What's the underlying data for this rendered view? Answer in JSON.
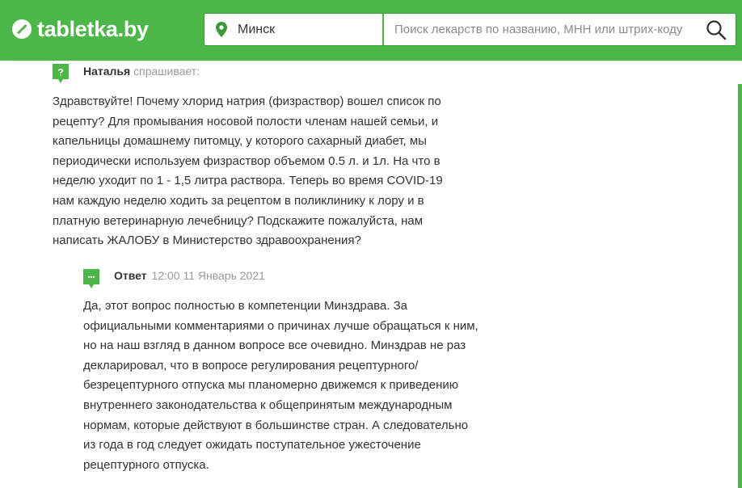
{
  "header": {
    "logo_text": "tabletka.by",
    "city": "Минск",
    "search_placeholder": "Поиск лекарств по названию, МНН или штрих-коду"
  },
  "question": {
    "author": "Наталья",
    "action": "спрашивает:",
    "icon_glyph": "?",
    "lines": [
      "Здравствуйте! Почему хлорид натрия (физраствор) вошел список по",
      "рецепту? Для промывания носовой полости членам нашей семьи, и",
      "капельницы домашнему питомцу, у которого сахарный диабет, мы",
      "периодически используем физраствор объемом 0.5 л. и 1л. На что в",
      "неделю уходит по 1 - 1,5 литра раствора. Теперь во время COVID-19",
      "нам каждую неделю ходить за рецептом в поликлинику к лору и в",
      "платную ветеринарную лечебницу? Подскажите пожалуйста, нам",
      "написать ЖАЛОБУ в Министерство здравоохранения?"
    ]
  },
  "answer": {
    "label": "Ответ",
    "datetime": "12:00 11 Январь 2021",
    "icon_glyph": "•••",
    "lines": [
      "Да, этот вопрос полностью в компетенции Минздрава. За",
      "официальными комментариями о причинах лучше обращаться к ним,",
      "но на наш взгляд в данном вопросе все очевидно. Минздрав не раз",
      "декларировал, что в вопросе регулирования рецептурного/",
      "безрецептурного отпуска мы планомерно движемся к приведению",
      "внутреннего законодательства к общепринятым международным",
      "нормам, которые действуют в большинстве стран. А следовательно",
      "из года в год следует ожидать поступательное ужесточение",
      "рецептурного отпуска."
    ]
  },
  "colors": {
    "brand_green": "#4cb748",
    "text": "#333333",
    "muted": "#999999"
  }
}
